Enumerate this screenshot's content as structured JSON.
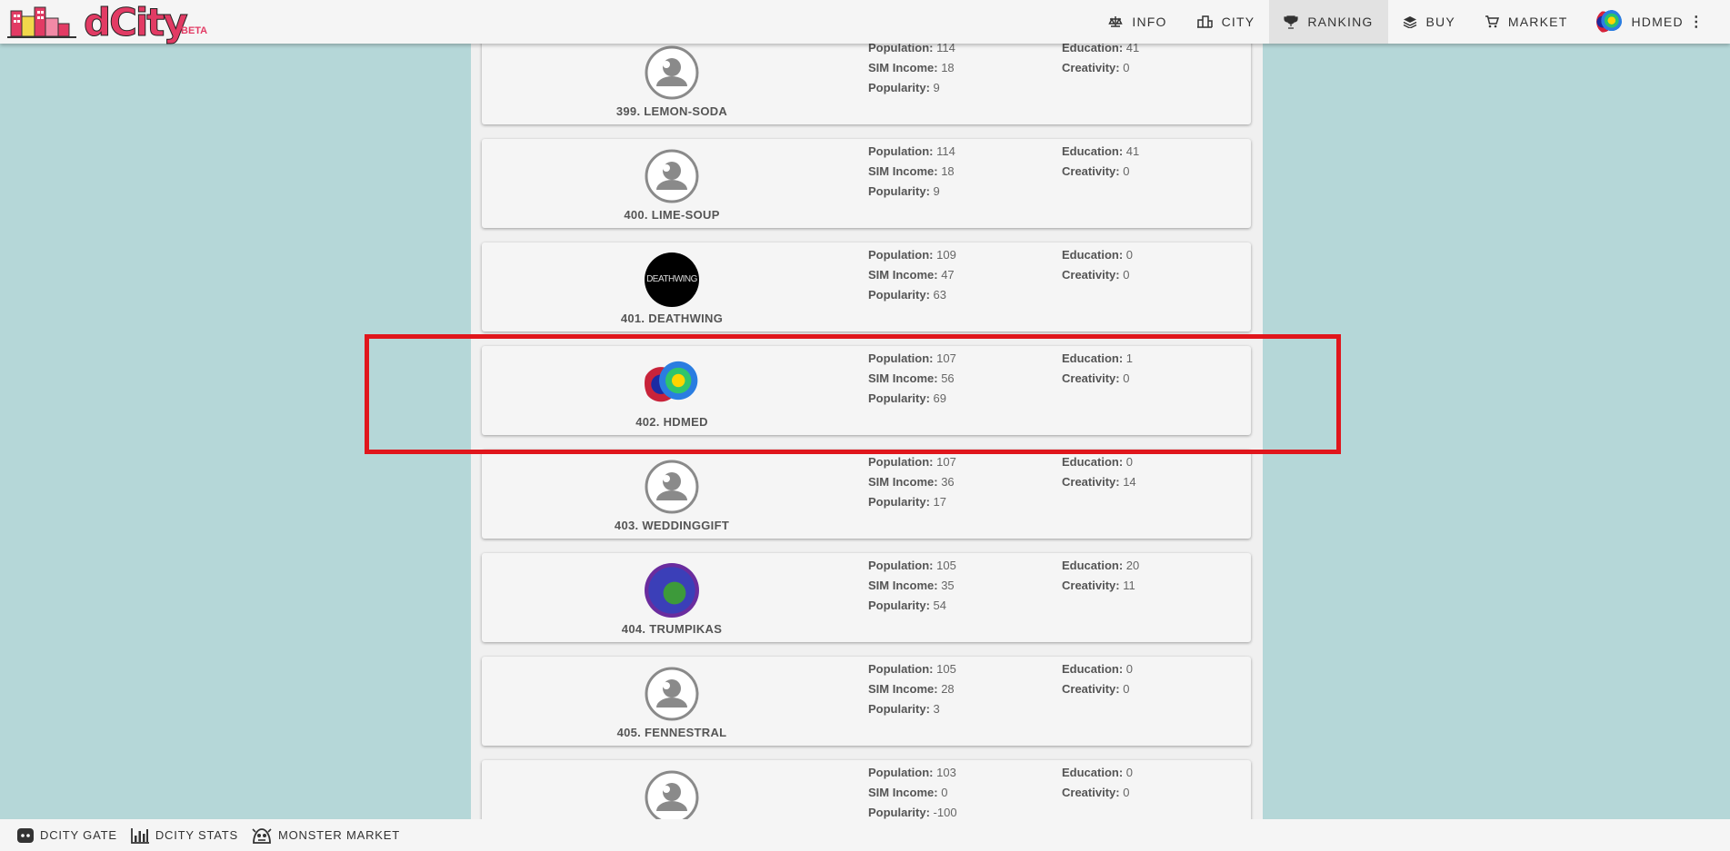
{
  "brand": {
    "name": "dCity",
    "badge": "BETA"
  },
  "nav": {
    "items": [
      {
        "label": "INFO",
        "icon": "scale-icon"
      },
      {
        "label": "CITY",
        "icon": "city-icon"
      },
      {
        "label": "RANKING",
        "icon": "trophy-icon",
        "active": true
      },
      {
        "label": "BUY",
        "icon": "stack-icon"
      },
      {
        "label": "MARKET",
        "icon": "cart-icon"
      }
    ],
    "user": "HDMED"
  },
  "labels": {
    "population": "Population:",
    "sim_income": "SIM Income:",
    "popularity": "Popularity:",
    "education": "Education:",
    "creativity": "Creativity:"
  },
  "ranking": [
    {
      "name": "399. LEMON-SODA",
      "population": "114",
      "sim_income": "18",
      "popularity": "9",
      "education": "41",
      "creativity": "0"
    },
    {
      "name": "400. LIME-SOUP",
      "population": "114",
      "sim_income": "18",
      "popularity": "9",
      "education": "41",
      "creativity": "0"
    },
    {
      "name": "401. DEATHWING",
      "avatar_text": "DEATHWING",
      "population": "109",
      "sim_income": "47",
      "popularity": "63",
      "education": "0",
      "creativity": "0"
    },
    {
      "name": "402. HDMED",
      "population": "107",
      "sim_income": "56",
      "popularity": "69",
      "education": "1",
      "creativity": "0"
    },
    {
      "name": "403. WEDDINGGIFT",
      "population": "107",
      "sim_income": "36",
      "popularity": "17",
      "education": "0",
      "creativity": "14"
    },
    {
      "name": "404. TRUMPIKAS",
      "population": "105",
      "sim_income": "35",
      "popularity": "54",
      "education": "20",
      "creativity": "11"
    },
    {
      "name": "405. FENNESTRAL",
      "population": "105",
      "sim_income": "28",
      "popularity": "3",
      "education": "0",
      "creativity": "0"
    },
    {
      "name": "",
      "population": "103",
      "sim_income": "0",
      "popularity": "-100",
      "education": "0",
      "creativity": "0"
    }
  ],
  "footer": {
    "items": [
      {
        "label": "DCITY GATE",
        "icon": "discord-icon"
      },
      {
        "label": "DCITY STATS",
        "icon": "bar-chart-icon"
      },
      {
        "label": "MONSTER MARKET",
        "icon": "monster-icon"
      }
    ]
  },
  "colors": {
    "highlight": "#e0161c",
    "background": "#b5d7d8"
  }
}
